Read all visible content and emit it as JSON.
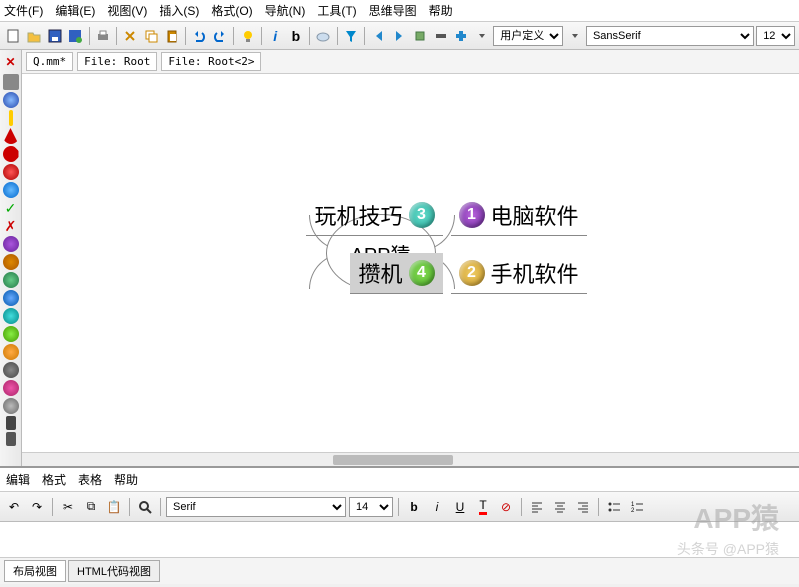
{
  "menubar": [
    "文件(F)",
    "编辑(E)",
    "视图(V)",
    "插入(S)",
    "格式(O)",
    "导航(N)",
    "工具(T)",
    "思维导图",
    "帮助"
  ],
  "toolbar1": {
    "style_combo": "用户定义.",
    "font_combo": "SansSerif",
    "size_combo": "12"
  },
  "tabs": [
    "Q.mm*",
    "File: Root",
    "File: Root<2>"
  ],
  "mindmap": {
    "center": "APP猿",
    "nodes": [
      {
        "id": "n1",
        "label": "电脑软件",
        "num": "1",
        "color": "#7b2d8e",
        "side": "right",
        "row": 0,
        "sel": false
      },
      {
        "id": "n2",
        "label": "手机软件",
        "num": "2",
        "color": "#d4a020",
        "side": "right",
        "row": 1,
        "sel": false
      },
      {
        "id": "n3",
        "label": "玩机技巧",
        "num": "3",
        "color": "#3aa89e",
        "side": "left",
        "row": 0,
        "sel": false
      },
      {
        "id": "n4",
        "label": "攒机",
        "num": "4",
        "color": "#4a9a3a",
        "side": "left",
        "row": 1,
        "sel": true
      }
    ]
  },
  "bottom_panel": {
    "menu": [
      "编辑",
      "格式",
      "表格",
      "帮助"
    ],
    "font_combo": "Serif",
    "size_combo": "14",
    "tabs": [
      "布局视图",
      "HTML代码视图"
    ]
  },
  "watermark": {
    "big": "APP猿",
    "small": "头条号 @APP猿"
  }
}
